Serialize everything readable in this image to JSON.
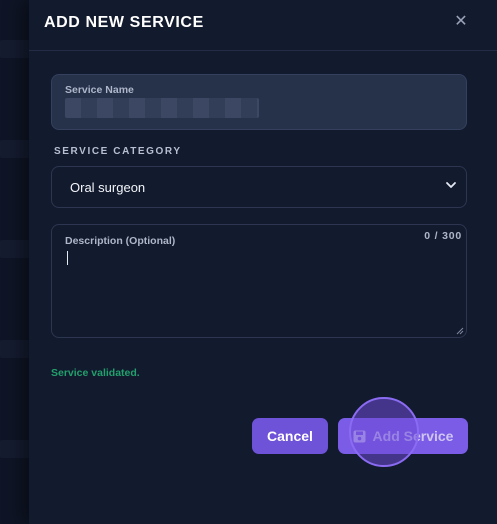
{
  "modal": {
    "title": "ADD NEW SERVICE",
    "close_icon": "close-icon"
  },
  "form": {
    "service_name": {
      "label": "Service Name",
      "value": ""
    },
    "category_section_label": "SERVICE CATEGORY",
    "category": {
      "selected": "Oral surgeon",
      "icon": "chevron-down-icon"
    },
    "description": {
      "label": "Description (Optional)",
      "counter": "0 / 300",
      "value": ""
    },
    "status_message": "Service validated."
  },
  "actions": {
    "cancel_label": "Cancel",
    "add_label": "Add Service",
    "add_icon": "save-icon"
  },
  "colors": {
    "accent": "#6e52d8",
    "success": "#22a06b",
    "background": "#121a2e"
  }
}
